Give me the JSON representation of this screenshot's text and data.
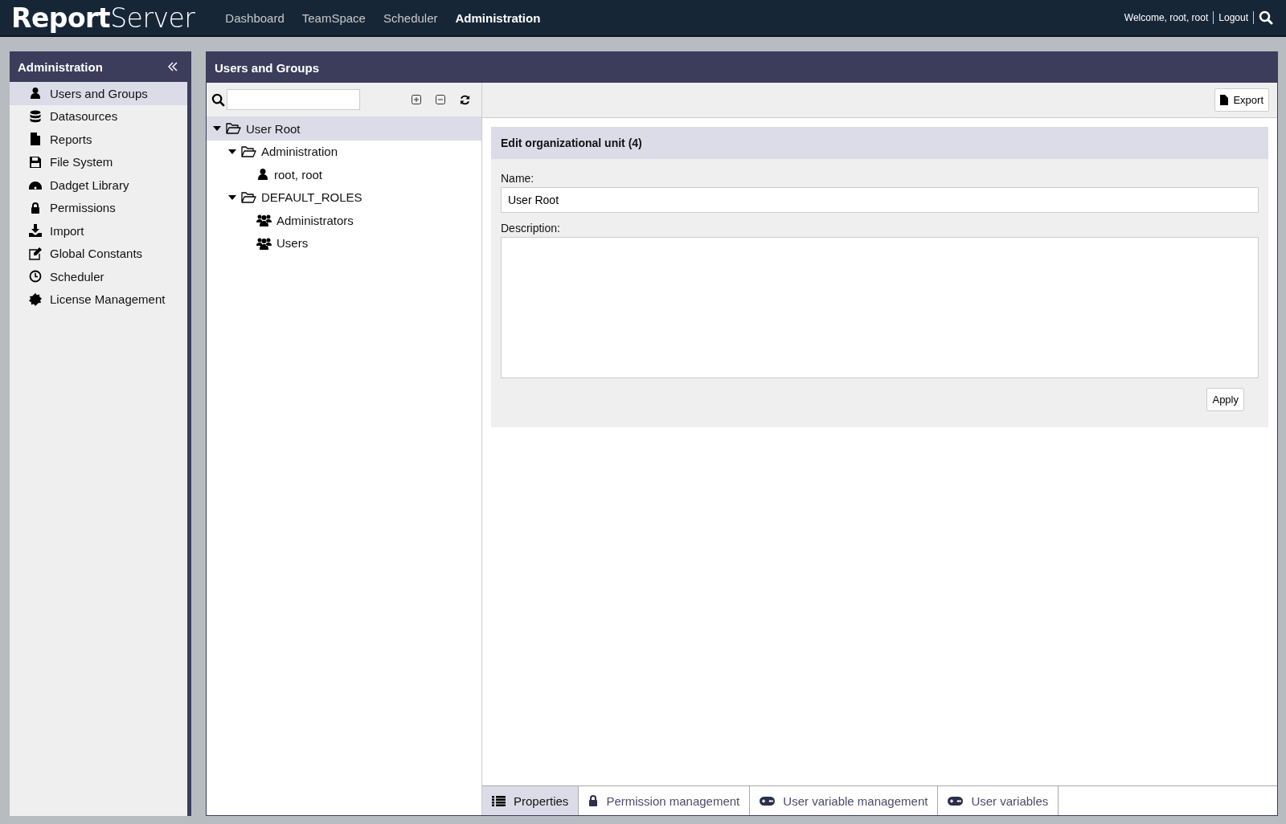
{
  "header": {
    "logo_bold": "Report",
    "logo_light": "Server",
    "nav": [
      {
        "label": "Dashboard",
        "selected": false
      },
      {
        "label": "TeamSpace",
        "selected": false
      },
      {
        "label": "Scheduler",
        "selected": false
      },
      {
        "label": "Administration",
        "selected": true
      }
    ],
    "welcome": "Welcome, root, root",
    "logout": "Logout"
  },
  "sidebar": {
    "title": "Administration",
    "items": [
      {
        "label": "Users and Groups",
        "selected": true
      },
      {
        "label": "Datasources",
        "selected": false
      },
      {
        "label": "Reports",
        "selected": false
      },
      {
        "label": "File System",
        "selected": false
      },
      {
        "label": "Dadget Library",
        "selected": false
      },
      {
        "label": "Permissions",
        "selected": false
      },
      {
        "label": "Import",
        "selected": false
      },
      {
        "label": "Global Constants",
        "selected": false
      },
      {
        "label": "Scheduler",
        "selected": false
      },
      {
        "label": "License Management",
        "selected": false
      }
    ]
  },
  "panel": {
    "title": "Users and Groups",
    "tree": [
      {
        "label": "User Root",
        "kind": "folder",
        "expanded": true,
        "selected": true,
        "children": [
          {
            "label": "Administration",
            "kind": "folder",
            "expanded": true,
            "selected": false,
            "children": [
              {
                "label": "root, root",
                "kind": "user",
                "selected": false
              }
            ]
          },
          {
            "label": "DEFAULT_ROLES",
            "kind": "folder",
            "expanded": true,
            "selected": false,
            "children": [
              {
                "label": "Administrators",
                "kind": "group",
                "selected": false
              },
              {
                "label": "Users",
                "kind": "group",
                "selected": false
              }
            ]
          }
        ]
      }
    ],
    "export_button": "Export",
    "form": {
      "title": "Edit organizational unit (4)",
      "name_label": "Name:",
      "name_value": "User Root",
      "description_label": "Description:",
      "apply_button": "Apply"
    },
    "tabs": [
      {
        "label": "Properties",
        "selected": true
      },
      {
        "label": "Permission management",
        "selected": false
      },
      {
        "label": "User variable management",
        "selected": false
      },
      {
        "label": "User variables",
        "selected": false
      }
    ]
  }
}
